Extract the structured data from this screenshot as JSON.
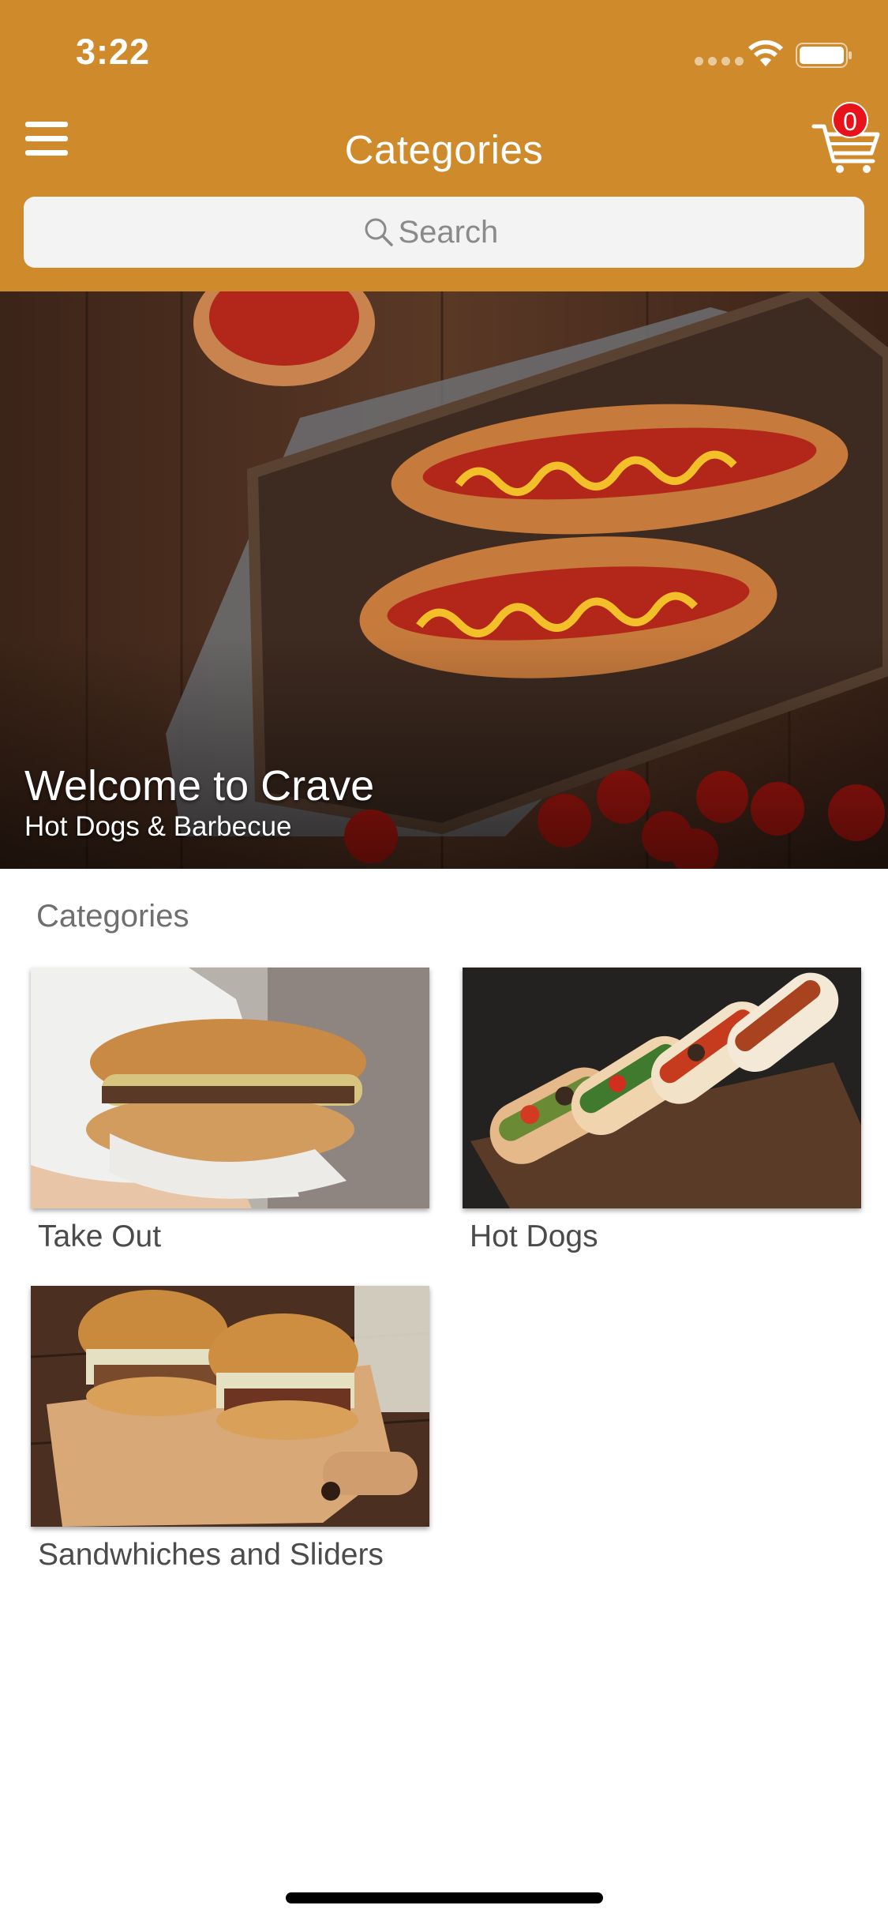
{
  "status_bar": {
    "time": "3:22"
  },
  "header": {
    "title": "Categories",
    "cart_count": "0",
    "background_color": "#cf8a2c"
  },
  "search": {
    "placeholder": "Search"
  },
  "hero": {
    "title": "Welcome to Crave",
    "subtitle": "Hot Dogs & Barbecue"
  },
  "categories": {
    "heading": "Categories",
    "items": [
      {
        "label": "Take Out"
      },
      {
        "label": "Hot Dogs"
      },
      {
        "label": "Sandwhiches and Sliders"
      }
    ]
  },
  "icons": [
    "hamburger-menu-icon",
    "cart-icon",
    "search-icon",
    "wifi-icon",
    "battery-icon"
  ]
}
